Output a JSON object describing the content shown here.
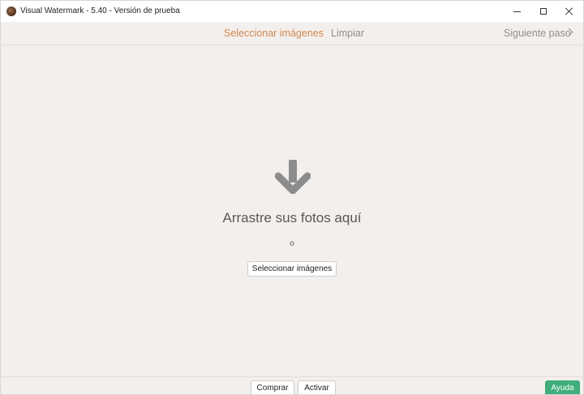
{
  "window": {
    "title": "Visual Watermark - 5.40 - Versión de prueba"
  },
  "toolbar": {
    "select_images": "Seleccionar imágenes",
    "clear": "Limpiar",
    "next_step": "Siguiente paso"
  },
  "dropzone": {
    "heading": "Arrastre sus fotos aquí",
    "or": "o",
    "select_button": "Seleccionar imágenes",
    "arrow_icon": "arrow-down-icon"
  },
  "footer": {
    "buy": "Comprar",
    "activate": "Activar",
    "help": "Ayuda"
  },
  "colors": {
    "accent_orange": "#d0884f",
    "help_green": "#3fae7b",
    "background": "#f3efed"
  }
}
